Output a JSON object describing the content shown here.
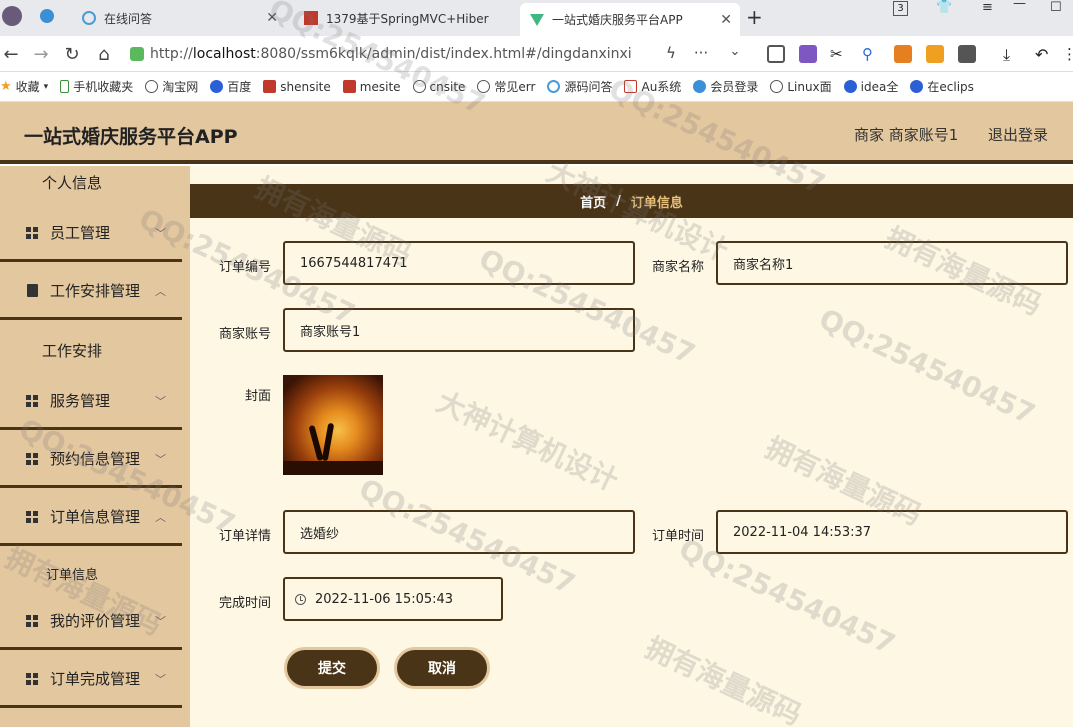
{
  "browser": {
    "tabs": [
      {
        "label": "在线问答"
      },
      {
        "label": "1379基于SpringMVC+Hiber"
      },
      {
        "label": "一站式婚庆服务平台APP"
      }
    ],
    "tab_counter": "3",
    "url_prefix": "http://",
    "url_host": "localhost",
    "url_rest": ":8080/ssm6kqlk/admin/dist/index.html#/dingdanxinxi",
    "bookmarks": [
      {
        "label": "收藏",
        "icon": "star-icon"
      },
      {
        "label": "手机收藏夹",
        "icon": "phone-icon"
      },
      {
        "label": "淘宝网",
        "icon": "globe-icon"
      },
      {
        "label": "百度",
        "icon": "paw-icon"
      },
      {
        "label": "shensite",
        "icon": "site-icon"
      },
      {
        "label": "mesite",
        "icon": "site-icon"
      },
      {
        "label": "cnsite",
        "icon": "globe-icon"
      },
      {
        "label": "常见err",
        "icon": "globe-icon"
      },
      {
        "label": "源码问答",
        "icon": "swirl-icon"
      },
      {
        "label": "Au系统",
        "icon": "au-icon"
      },
      {
        "label": "会员登录",
        "icon": "cloud-icon"
      },
      {
        "label": "Linux面",
        "icon": "globe-icon"
      },
      {
        "label": "idea全",
        "icon": "paw-icon"
      },
      {
        "label": "在eclips",
        "icon": "paw-icon"
      }
    ]
  },
  "app": {
    "title": "一站式婚庆服务平台APP",
    "user": "商家 商家账号1",
    "logout": "退出登录"
  },
  "sidebar": {
    "items": [
      {
        "label": "个人信息"
      },
      {
        "label": "员工管理"
      },
      {
        "label": "工作安排管理"
      },
      {
        "label": "工作安排"
      },
      {
        "label": "服务管理"
      },
      {
        "label": "预约信息管理"
      },
      {
        "label": "订单信息管理"
      },
      {
        "label": "订单信息"
      },
      {
        "label": "我的评价管理"
      },
      {
        "label": "订单完成管理"
      }
    ]
  },
  "breadcrumb": {
    "home": "首页",
    "sep": "/",
    "current": "订单信息"
  },
  "form": {
    "order_no_label": "订单编号",
    "order_no": "1667544817471",
    "merchant_name_label": "商家名称",
    "merchant_name": "商家名称1",
    "merchant_account_label": "商家账号",
    "merchant_account": "商家账号1",
    "cover_label": "封面",
    "order_detail_label": "订单详情",
    "order_detail": "选婚纱",
    "order_time_label": "订单时间",
    "order_time": "2022-11-04 14:53:37",
    "finish_time_label": "完成时间",
    "finish_time": "2022-11-06 15:05:43",
    "submit": "提交",
    "cancel": "取消"
  },
  "watermarks": [
    "QQ:254540457",
    "拥有海量源码",
    "大神计算机设计"
  ]
}
